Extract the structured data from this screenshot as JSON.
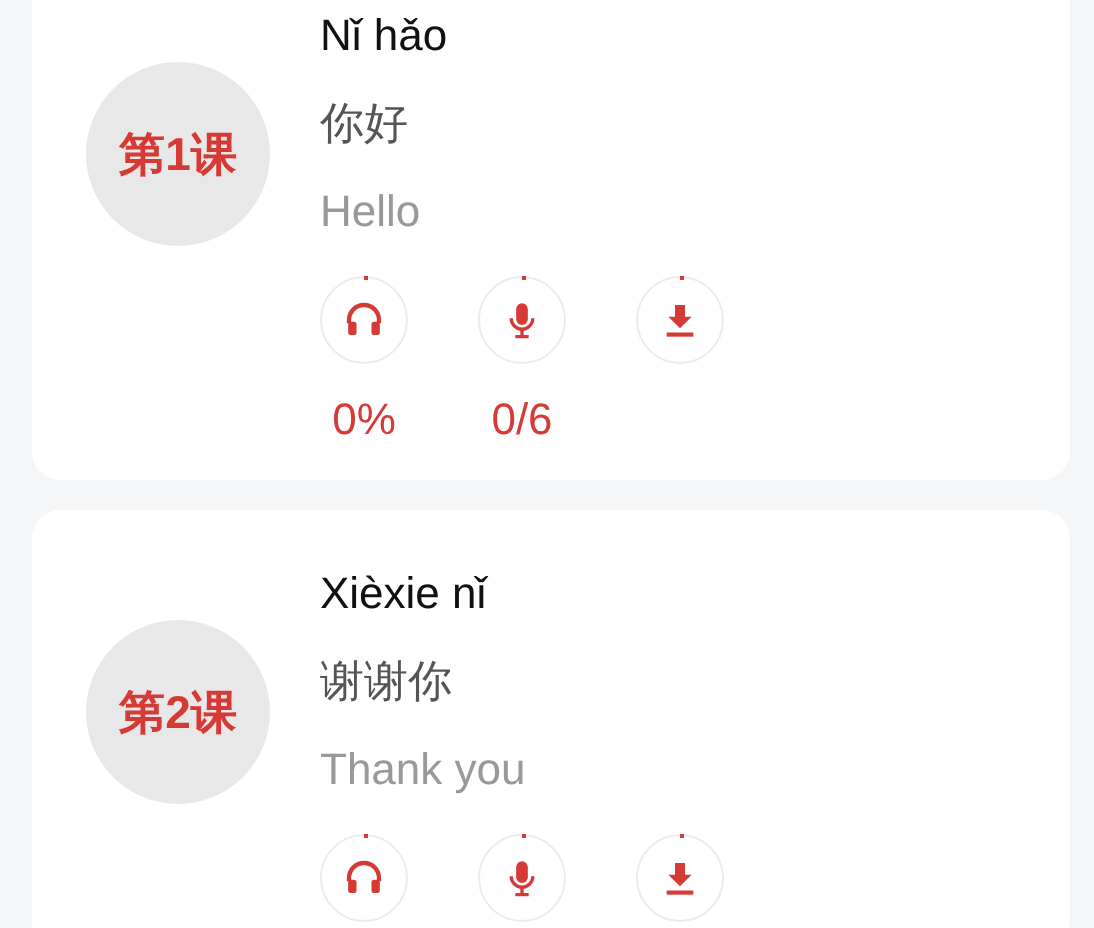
{
  "lessons": [
    {
      "badge": "第1课",
      "pinyin": "Nǐ hǎo",
      "hanzi": "你好",
      "english": "Hello",
      "actions": [
        {
          "kind": "listen",
          "stat": "0%"
        },
        {
          "kind": "speak",
          "stat": "0/6"
        },
        {
          "kind": "download"
        }
      ]
    },
    {
      "badge": "第2课",
      "pinyin": "Xièxie nǐ",
      "hanzi": "谢谢你",
      "english": "Thank you",
      "actions": [
        {
          "kind": "listen"
        },
        {
          "kind": "speak"
        },
        {
          "kind": "download"
        }
      ]
    }
  ]
}
